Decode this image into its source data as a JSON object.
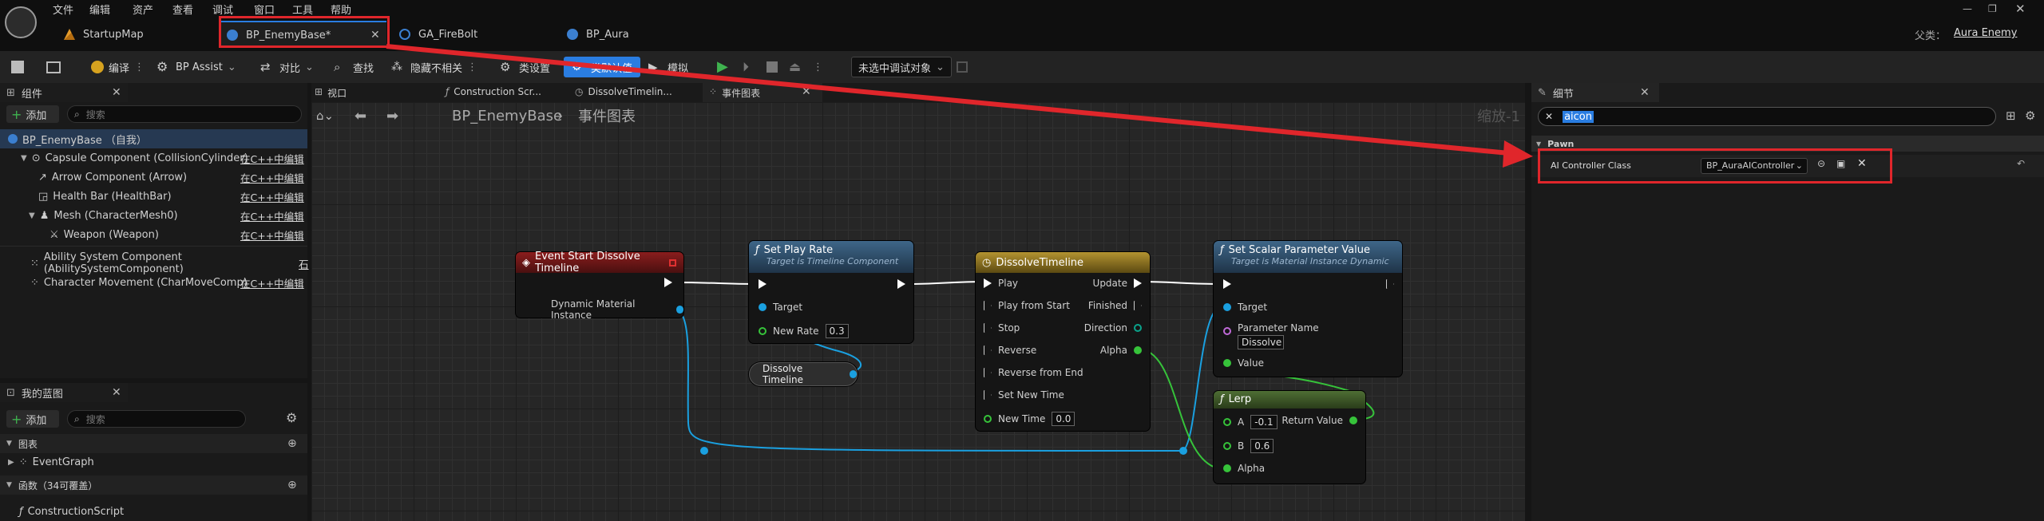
{
  "menu": [
    "文件",
    "编辑",
    "资产",
    "查看",
    "调试",
    "窗口",
    "工具",
    "帮助"
  ],
  "tabs": [
    {
      "label": "StartupMap",
      "kind": "map"
    },
    {
      "label": "BP_EnemyBase*",
      "kind": "bp",
      "active": true
    },
    {
      "label": "GA_FireBolt",
      "kind": "ga"
    },
    {
      "label": "BP_Aura",
      "kind": "bp"
    }
  ],
  "parent": {
    "label": "父类：",
    "value": "Aura Enemy"
  },
  "toolbar": {
    "compile": "编译",
    "bp_assist": "BP Assist",
    "diff": "对比",
    "find": "查找",
    "hide_unrelated": "隐藏不相关",
    "class_settings": "类设置",
    "class_defaults": "类默认值",
    "simulate": "模拟",
    "debug_object": "未选中调试对象"
  },
  "components": {
    "title": "组件",
    "add": "添加",
    "search_placeholder": "搜索",
    "items": [
      {
        "name": "BP_EnemyBase （自我）",
        "edit": ""
      },
      {
        "name": "Capsule Component (CollisionCylinder)",
        "edit": "在C++中编辑"
      },
      {
        "name": "Arrow Component (Arrow)",
        "edit": "在C++中编辑"
      },
      {
        "name": "Health Bar (HealthBar)",
        "edit": "在C++中编辑"
      },
      {
        "name": "Mesh (CharacterMesh0)",
        "edit": "在C++中编辑"
      },
      {
        "name": "Weapon (Weapon)",
        "edit": "在C++中编辑"
      },
      {
        "name": "Ability System Component (AbilitySystemComponent)",
        "edit": "石"
      },
      {
        "name": "Character Movement (CharMoveComp)",
        "edit": "在C++中编辑"
      }
    ]
  },
  "mybp": {
    "title": "我的蓝图",
    "add": "添加",
    "search_placeholder": "搜索",
    "graphs_label": "图表",
    "event_graph": "EventGraph",
    "functions_label": "函数（34可覆盖）",
    "construction": "ConstructionScript"
  },
  "graph_tabs": [
    "视口",
    "Construction Scr...",
    "DissolveTimelin...",
    "事件图表"
  ],
  "breadcrumb": {
    "root": "BP_EnemyBase",
    "sep": "›",
    "current": "事件图表",
    "zoom": "缩放-1"
  },
  "details": {
    "title": "细节",
    "search_value": "aicon",
    "section": "Pawn",
    "prop_label": "AI Controller Class",
    "prop_value": "BP_AuraAIController"
  },
  "nodes": {
    "event": {
      "title": "Event Start Dissolve Timeline",
      "pin": "Dynamic Material Instance"
    },
    "setplay": {
      "title": "Set Play Rate",
      "subtitle": "Target is Timeline Component",
      "target": "Target",
      "newrate": "New Rate",
      "newrate_val": "0.3"
    },
    "dissolve_var": {
      "title": "Dissolve Timeline"
    },
    "timeline": {
      "title": "DissolveTimeline",
      "inputs": [
        "Play",
        "Play from Start",
        "Stop",
        "Reverse",
        "Reverse from End",
        "Set New Time"
      ],
      "newtime": "New Time",
      "newtime_val": "0.0",
      "outputs": [
        "Update",
        "Finished",
        "Direction",
        "Alpha"
      ]
    },
    "setscalar": {
      "title": "Set Scalar Parameter Value",
      "subtitle": "Target is Material Instance Dynamic",
      "target": "Target",
      "param": "Parameter Name",
      "param_val": "Dissolve",
      "value": "Value"
    },
    "lerp": {
      "title": "Lerp",
      "a": "A",
      "a_val": "-0.1",
      "b": "B",
      "b_val": "0.6",
      "alpha": "Alpha",
      "ret": "Return Value"
    }
  },
  "colors": {
    "highlight": "#e0262b",
    "accent": "#2a7de1",
    "event": "#7a1a1a",
    "func": "#2f4a66",
    "timeline": "#a88b2a",
    "pure": "#3a5a2a"
  }
}
